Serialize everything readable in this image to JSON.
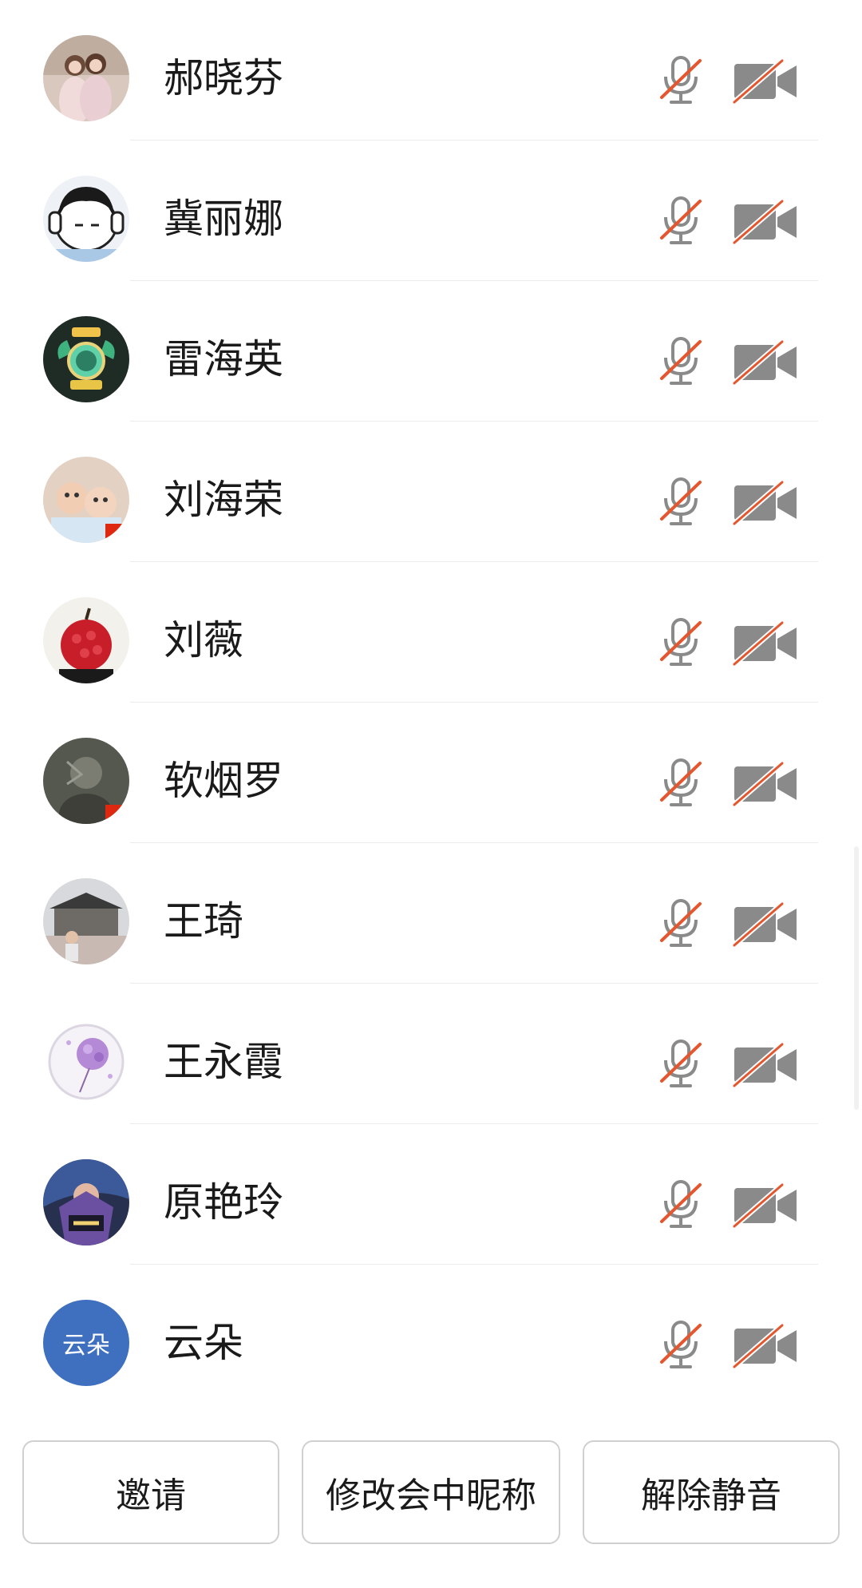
{
  "participants": [
    {
      "name": "郝晓芬",
      "avatar": "photo-two-women-icon",
      "avatar_bg": "#c9b7a9",
      "mic": "muted",
      "camera": "off"
    },
    {
      "name": "冀丽娜",
      "avatar": "cartoon-girl-headphones-icon",
      "avatar_bg": "#e8eef5",
      "mic": "muted",
      "camera": "off"
    },
    {
      "name": "雷海英",
      "avatar": "badge-medal-icon",
      "avatar_bg": "#1d2a24",
      "mic": "muted",
      "camera": "off"
    },
    {
      "name": "刘海荣",
      "avatar": "photo-babies-icon",
      "avatar_bg": "#d9c2b0",
      "mic": "muted",
      "camera": "off"
    },
    {
      "name": "刘薇",
      "avatar": "red-apple-flower-icon",
      "avatar_bg": "#f0eee9",
      "mic": "muted",
      "camera": "off"
    },
    {
      "name": "软烟罗",
      "avatar": "photo-dark-portrait-icon",
      "avatar_bg": "#5b5d54",
      "mic": "muted",
      "camera": "off"
    },
    {
      "name": "王琦",
      "avatar": "photo-building-person-icon",
      "avatar_bg": "#b8b6b3",
      "mic": "muted",
      "camera": "off"
    },
    {
      "name": "王永霞",
      "avatar": "purple-dandelion-icon",
      "avatar_bg": "#f7f4f8",
      "mic": "muted",
      "camera": "off"
    },
    {
      "name": "原艳玲",
      "avatar": "game-poster-icon",
      "avatar_bg": "#2b3552",
      "mic": "muted",
      "camera": "off"
    },
    {
      "name": "云朵",
      "avatar": "text-avatar",
      "avatar_text": "云朵",
      "avatar_bg": "#3f6fbf",
      "mic": "muted",
      "camera": "off"
    }
  ],
  "actions": {
    "invite_label": "邀请",
    "rename_label": "修改会中昵称",
    "unmute_label": "解除静音"
  },
  "colors": {
    "muted_slash": "#e4572e",
    "icon_gray": "#8a8a8a",
    "divider": "#ececec"
  }
}
